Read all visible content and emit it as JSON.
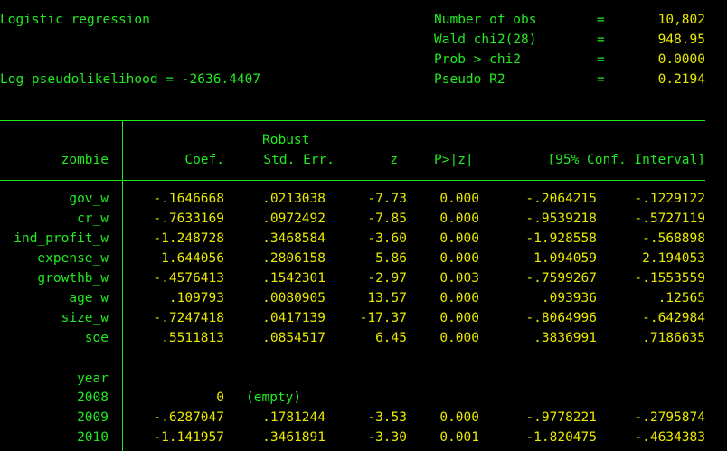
{
  "header": {
    "title": "Logistic regression",
    "log_likelihood": "Log pseudolikelihood = -2636.4407",
    "stats": [
      {
        "label": "Number of obs",
        "eq": "=",
        "value": "10,802"
      },
      {
        "label": "Wald chi2(28)",
        "eq": "=",
        "value": "948.95"
      },
      {
        "label": "Prob > chi2",
        "eq": "=",
        "value": "0.0000"
      },
      {
        "label": "Pseudo R2",
        "eq": "=",
        "value": "0.2194"
      }
    ]
  },
  "table": {
    "header_robust": "Robust",
    "depvar": "zombie",
    "columns": [
      "Coef.",
      "Std. Err.",
      "z",
      "P>|z|",
      "[95% Conf. Interval]"
    ],
    "rows": [
      {
        "name": "gov_w",
        "coef": "-.1646668",
        "se": ".0213038",
        "z": "-7.73",
        "p": "0.000",
        "lo": "-.2064215",
        "hi": "-.1229122"
      },
      {
        "name": "cr_w",
        "coef": "-.7633169",
        "se": ".0972492",
        "z": "-7.85",
        "p": "0.000",
        "lo": "-.9539218",
        "hi": "-.5727119"
      },
      {
        "name": "ind_profit_w",
        "coef": "-1.248728",
        "se": ".3468584",
        "z": "-3.60",
        "p": "0.000",
        "lo": "-1.928558",
        "hi": "-.568898"
      },
      {
        "name": "expense_w",
        "coef": "1.644056",
        "se": ".2806158",
        "z": "5.86",
        "p": "0.000",
        "lo": "1.094059",
        "hi": "2.194053"
      },
      {
        "name": "growthb_w",
        "coef": "-.4576413",
        "se": ".1542301",
        "z": "-2.97",
        "p": "0.003",
        "lo": "-.7599267",
        "hi": "-.1553559"
      },
      {
        "name": "age_w",
        "coef": ".109793",
        "se": ".0080905",
        "z": "13.57",
        "p": "0.000",
        "lo": ".093936",
        "hi": ".12565"
      },
      {
        "name": "size_w",
        "coef": "-.7247418",
        "se": ".0417139",
        "z": "-17.37",
        "p": "0.000",
        "lo": "-.8064996",
        "hi": "-.642984"
      },
      {
        "name": "soe",
        "coef": ".5511813",
        "se": ".0854517",
        "z": "6.45",
        "p": "0.000",
        "lo": ".3836991",
        "hi": ".7186635"
      }
    ],
    "year_label": "year",
    "year_rows": [
      {
        "name": "2008",
        "coef": "0",
        "se": "(empty)",
        "z": "",
        "p": "",
        "lo": "",
        "hi": ""
      },
      {
        "name": "2009",
        "coef": "-.6287047",
        "se": ".1781244",
        "z": "-3.53",
        "p": "0.000",
        "lo": "-.9778221",
        "hi": "-.2795874"
      },
      {
        "name": "2010",
        "coef": "-1.141957",
        "se": ".3461891",
        "z": "-3.30",
        "p": "0.001",
        "lo": "-1.820475",
        "hi": "-.4634383"
      }
    ]
  }
}
